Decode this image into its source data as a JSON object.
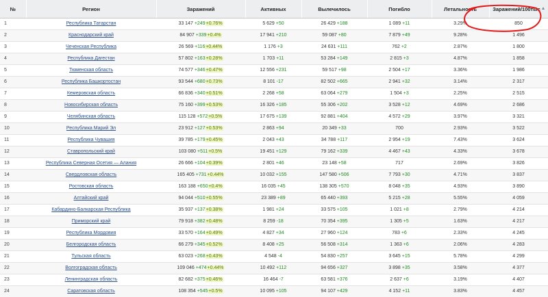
{
  "headers": {
    "num": "№",
    "region": "Регион",
    "cases": "Заражений",
    "active": "Активных",
    "recovered": "Вылечилось",
    "deaths": "Погибло",
    "lethality": "Летальность",
    "per100k": "Заражений/100тыс"
  },
  "accent_colors": {
    "annotation": "#e31b1b",
    "link": "#2a4f8c",
    "increase": "#1d8a1d"
  },
  "rows": [
    {
      "n": "1",
      "region": "Республика Татарстан",
      "cases": "33 147",
      "cases_d": "+249",
      "cases_p": "+0.76%",
      "active": "5 629",
      "active_d": "+50",
      "recovered": "26 429",
      "recovered_d": "+188",
      "deaths": "1 089",
      "deaths_d": "+11",
      "lethality": "3.29%",
      "per100k": "850"
    },
    {
      "n": "2",
      "region": "Краснодарский край",
      "cases": "84 907",
      "cases_d": "+339",
      "cases_p": "+0.4%",
      "active": "17 941",
      "active_d": "+210",
      "recovered": "59 087",
      "recovered_d": "+80",
      "deaths": "7 879",
      "deaths_d": "+49",
      "lethality": "9.28%",
      "per100k": "1 496"
    },
    {
      "n": "3",
      "region": "Чеченская Республика",
      "cases": "26 569",
      "cases_d": "+116",
      "cases_p": "+0.44%",
      "active": "1 176",
      "active_d": "+3",
      "recovered": "24 631",
      "recovered_d": "+111",
      "deaths": "762",
      "deaths_d": "+2",
      "lethality": "2.87%",
      "per100k": "1 800"
    },
    {
      "n": "4",
      "region": "Республика Дагестан",
      "cases": "57 802",
      "cases_d": "+163",
      "cases_p": "+0.28%",
      "active": "1 703",
      "active_d": "+11",
      "recovered": "53 284",
      "recovered_d": "+149",
      "deaths": "2 815",
      "deaths_d": "+3",
      "lethality": "4.87%",
      "per100k": "1 858"
    },
    {
      "n": "5",
      "region": "Тюменская область",
      "cases": "74 577",
      "cases_d": "+346",
      "cases_p": "+0.47%",
      "active": "12 556",
      "active_d": "+231",
      "recovered": "59 517",
      "recovered_d": "+98",
      "deaths": "2 504",
      "deaths_d": "+17",
      "lethality": "3.36%",
      "per100k": "1 986"
    },
    {
      "n": "6",
      "region": "Республика Башкортостан",
      "cases": "93 544",
      "cases_d": "+680",
      "cases_p": "+0.73%",
      "active": "8 101",
      "active_d": "-17",
      "recovered": "82 502",
      "recovered_d": "+665",
      "deaths": "2 941",
      "deaths_d": "+32",
      "lethality": "3.14%",
      "per100k": "2 317"
    },
    {
      "n": "7",
      "region": "Кемеровская область",
      "cases": "66 836",
      "cases_d": "+340",
      "cases_p": "+0.51%",
      "active": "2 268",
      "active_d": "+58",
      "recovered": "63 064",
      "recovered_d": "+279",
      "deaths": "1 504",
      "deaths_d": "+3",
      "lethality": "2.25%",
      "per100k": "2 515"
    },
    {
      "n": "8",
      "region": "Новосибирская область",
      "cases": "75 160",
      "cases_d": "+399",
      "cases_p": "+0.53%",
      "active": "16 326",
      "active_d": "+185",
      "recovered": "55 306",
      "recovered_d": "+202",
      "deaths": "3 528",
      "deaths_d": "+12",
      "lethality": "4.69%",
      "per100k": "2 686"
    },
    {
      "n": "9",
      "region": "Челябинская область",
      "cases": "115 128",
      "cases_d": "+572",
      "cases_p": "+0.5%",
      "active": "17 675",
      "active_d": "+139",
      "recovered": "92 881",
      "recovered_d": "+404",
      "deaths": "4 572",
      "deaths_d": "+29",
      "lethality": "3.97%",
      "per100k": "3 321"
    },
    {
      "n": "10",
      "region": "Республика Марий Эл",
      "cases": "23 912",
      "cases_d": "+127",
      "cases_p": "+0.53%",
      "active": "2 863",
      "active_d": "+94",
      "recovered": "20 349",
      "recovered_d": "+33",
      "deaths": "700",
      "deaths_d": "",
      "lethality": "2.93%",
      "per100k": "3 522"
    },
    {
      "n": "11",
      "region": "Республика Чувашия",
      "cases": "39 785",
      "cases_d": "+179",
      "cases_p": "+0.45%",
      "active": "2 043",
      "active_d": "+43",
      "recovered": "34 788",
      "recovered_d": "+117",
      "deaths": "2 954",
      "deaths_d": "+19",
      "lethality": "7.43%",
      "per100k": "3 624"
    },
    {
      "n": "12",
      "region": "Ставропольский край",
      "cases": "103 080",
      "cases_d": "+511",
      "cases_p": "+0.5%",
      "active": "19 451",
      "active_d": "+129",
      "recovered": "79 162",
      "recovered_d": "+339",
      "deaths": "4 467",
      "deaths_d": "+43",
      "lethality": "4.33%",
      "per100k": "3 678"
    },
    {
      "n": "13",
      "region": "Республика Северная Осетия — Алания",
      "cases": "26 666",
      "cases_d": "+104",
      "cases_p": "+0.39%",
      "active": "2 801",
      "active_d": "+46",
      "recovered": "23 148",
      "recovered_d": "+58",
      "deaths": "717",
      "deaths_d": "",
      "lethality": "2.69%",
      "per100k": "3 826"
    },
    {
      "n": "14",
      "region": "Свердловская область",
      "cases": "165 405",
      "cases_d": "+731",
      "cases_p": "+0.44%",
      "active": "10 032",
      "active_d": "+155",
      "recovered": "147 580",
      "recovered_d": "+506",
      "deaths": "7 793",
      "deaths_d": "+30",
      "lethality": "4.71%",
      "per100k": "3 837"
    },
    {
      "n": "15",
      "region": "Ростовская область",
      "cases": "163 188",
      "cases_d": "+650",
      "cases_p": "+0.4%",
      "active": "16 035",
      "active_d": "+45",
      "recovered": "138 305",
      "recovered_d": "+570",
      "deaths": "8 048",
      "deaths_d": "+35",
      "lethality": "4.93%",
      "per100k": "3 890"
    },
    {
      "n": "16",
      "region": "Алтайский край",
      "cases": "94 044",
      "cases_d": "+510",
      "cases_p": "+0.55%",
      "active": "23 389",
      "active_d": "+89",
      "recovered": "65 440",
      "recovered_d": "+393",
      "deaths": "5 215",
      "deaths_d": "+28",
      "lethality": "5.55%",
      "per100k": "4 059"
    },
    {
      "n": "17",
      "region": "Кабардино-Балкарская Республика",
      "cases": "35 937",
      "cases_d": "+137",
      "cases_p": "+0.38%",
      "active": "1 981",
      "active_d": "+24",
      "recovered": "33 575",
      "recovered_d": "+105",
      "deaths": "1 021",
      "deaths_d": "+8",
      "lethality": "2.79%",
      "per100k": "4 214"
    },
    {
      "n": "18",
      "region": "Приморский край",
      "cases": "79 918",
      "cases_d": "+382",
      "cases_p": "+0.48%",
      "active": "8 259",
      "active_d": "-18",
      "recovered": "70 354",
      "recovered_d": "+395",
      "deaths": "1 305",
      "deaths_d": "+5",
      "lethality": "1.63%",
      "per100k": "4 217"
    },
    {
      "n": "19",
      "region": "Республика Мордовия",
      "cases": "33 570",
      "cases_d": "+164",
      "cases_p": "+0.49%",
      "active": "4 827",
      "active_d": "+34",
      "recovered": "27 960",
      "recovered_d": "+124",
      "deaths": "783",
      "deaths_d": "+6",
      "lethality": "2.33%",
      "per100k": "4 245"
    },
    {
      "n": "20",
      "region": "Белгородская область",
      "cases": "66 279",
      "cases_d": "+345",
      "cases_p": "+0.52%",
      "active": "8 408",
      "active_d": "+25",
      "recovered": "56 508",
      "recovered_d": "+314",
      "deaths": "1 363",
      "deaths_d": "+6",
      "lethality": "2.06%",
      "per100k": "4 283"
    },
    {
      "n": "21",
      "region": "Тульская область",
      "cases": "63 023",
      "cases_d": "+268",
      "cases_p": "+0.43%",
      "active": "4 548",
      "active_d": "-4",
      "recovered": "54 830",
      "recovered_d": "+257",
      "deaths": "3 645",
      "deaths_d": "+15",
      "lethality": "5.78%",
      "per100k": "4 299"
    },
    {
      "n": "22",
      "region": "Волгоградская область",
      "cases": "109 046",
      "cases_d": "+474",
      "cases_p": "+0.44%",
      "active": "10 492",
      "active_d": "+112",
      "recovered": "94 656",
      "recovered_d": "+327",
      "deaths": "3 898",
      "deaths_d": "+35",
      "lethality": "3.58%",
      "per100k": "4 377"
    },
    {
      "n": "23",
      "region": "Ленинградская область",
      "cases": "82 682",
      "cases_d": "+375",
      "cases_p": "+0.46%",
      "active": "16 464",
      "active_d": "-7",
      "recovered": "63 581",
      "recovered_d": "+376",
      "deaths": "2 637",
      "deaths_d": "+6",
      "lethality": "3.19%",
      "per100k": "4 407"
    },
    {
      "n": "24",
      "region": "Саратовская область",
      "cases": "108 354",
      "cases_d": "+545",
      "cases_p": "+0.5%",
      "active": "10 095",
      "active_d": "+105",
      "recovered": "94 107",
      "recovered_d": "+429",
      "deaths": "4 152",
      "deaths_d": "+11",
      "lethality": "3.83%",
      "per100k": "4 457"
    }
  ]
}
